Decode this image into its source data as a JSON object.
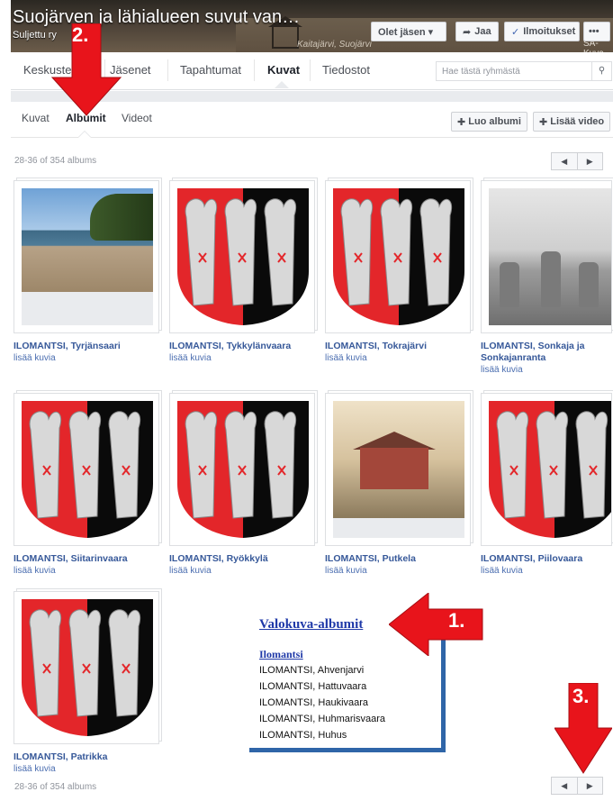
{
  "header": {
    "group_title": "Suojärven ja lähialueen suvut van…",
    "group_status": "Suljettu ry",
    "cover_caption_left": "Kaitajärvi, Suojärvi",
    "cover_caption_right": "SA-Kuva",
    "member_button": "Olet jäsen ▾",
    "share_button": "Jaa",
    "notify_button": "Ilmoitukset",
    "more_button": "•••"
  },
  "tabs": [
    "Keskustelu",
    "Jäsenet",
    "Tapahtumat",
    "Kuvat",
    "Tiedostot"
  ],
  "active_tab": "Kuvat",
  "search": {
    "placeholder": "Hae tästä ryhmästä"
  },
  "subtabs": [
    "Kuvat",
    "Albumit",
    "Videot"
  ],
  "active_subtab": "Albumit",
  "actions": {
    "create_album": "Luo albumi",
    "add_video": "Lisää video"
  },
  "pagination": {
    "count_top": "28-36 of 354 albums",
    "count_bottom": "28-36 of 354 albums",
    "prev": "◀",
    "next": "▶"
  },
  "albums": [
    {
      "name": "ILOMANTSI, Tyrjänsaari",
      "more": "lisää kuvia",
      "cover": "lake-photo"
    },
    {
      "name": "ILOMANTSI, Tykkylänvaara",
      "more": "lisää kuvia",
      "cover": "coat-of-arms"
    },
    {
      "name": "ILOMANTSI, Tokrajärvi",
      "more": "lisää kuvia",
      "cover": "coat-of-arms"
    },
    {
      "name": "ILOMANTSI, Sonkaja ja Sonkajanranta",
      "more": "lisää kuvia",
      "cover": "bw-photo"
    },
    {
      "name": "ILOMANTSI, Siitarinvaara",
      "more": "lisää kuvia",
      "cover": "coat-of-arms"
    },
    {
      "name": "ILOMANTSI, Ryökkylä",
      "more": "lisää kuvia",
      "cover": "coat-of-arms"
    },
    {
      "name": "ILOMANTSI, Putkela",
      "more": "lisää kuvia",
      "cover": "house-photo"
    },
    {
      "name": "ILOMANTSI, Piilovaara",
      "more": "lisää kuvia",
      "cover": "coat-of-arms"
    },
    {
      "name": "ILOMANTSI, Patrikka",
      "more": "lisää kuvia",
      "cover": "coat-of-arms"
    }
  ],
  "document_overlay": {
    "title": "Valokuva-albumit",
    "subtitle": "Ilomantsi",
    "lines": [
      "ILOMANTSI, Ahvenjarvi",
      "ILOMANTSI, Hattuvaara",
      "ILOMANTSI, Haukivaara",
      "ILOMANTSI, Huhmarisvaara",
      "ILOMANTSI, Huhus"
    ]
  },
  "annotations": {
    "arrow_1": "1.",
    "arrow_2": "2.",
    "arrow_3": "3."
  },
  "colors": {
    "link": "#365899",
    "arrow_red": "#e8141b",
    "shield_red": "#e3262a",
    "shield_black": "#0a0a0a",
    "doc_shadow": "#2f65a8"
  }
}
